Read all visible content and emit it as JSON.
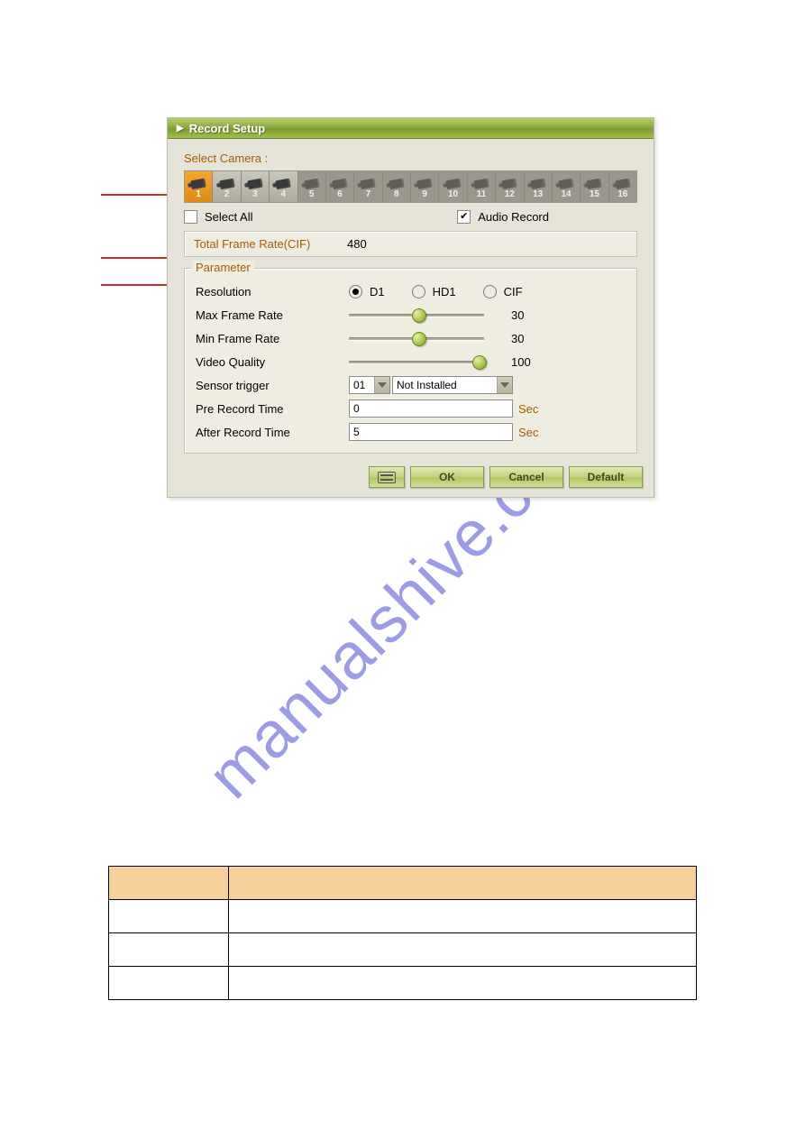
{
  "watermark_text": "manualshive.com",
  "dialog": {
    "title": "Record Setup",
    "select_camera_label": "Select Camera :",
    "cameras": [
      "1",
      "2",
      "3",
      "4",
      "5",
      "6",
      "7",
      "8",
      "9",
      "10",
      "11",
      "12",
      "13",
      "14",
      "15",
      "16"
    ],
    "selected_camera_index": 0,
    "available_camera_indices": [
      0,
      1,
      2,
      3
    ],
    "select_all_label": "Select All",
    "select_all_checked": false,
    "audio_record_label": "Audio Record",
    "audio_record_checked": true,
    "total_frame_rate_label": "Total Frame Rate(CIF)",
    "total_frame_rate_value": "480",
    "parameter_legend": "Parameter",
    "resolution_label": "Resolution",
    "resolution_options": [
      "D1",
      "HD1",
      "CIF"
    ],
    "resolution_selected": "D1",
    "max_frame_rate_label": "Max Frame Rate",
    "max_frame_rate_value": "30",
    "min_frame_rate_label": "Min Frame Rate",
    "min_frame_rate_value": "30",
    "video_quality_label": "Video Quality",
    "video_quality_value": "100",
    "sensor_trigger_label": "Sensor trigger",
    "sensor_trigger_num": "01",
    "sensor_trigger_status": "Not Installed",
    "pre_record_time_label": "Pre Record Time",
    "pre_record_time_value": "0",
    "after_record_time_label": "After Record Time",
    "after_record_time_value": "5",
    "sec_unit": "Sec",
    "buttons": {
      "ok": "OK",
      "cancel": "Cancel",
      "default": "Default"
    }
  },
  "table": {
    "headers": [
      "",
      ""
    ],
    "rows": [
      [
        "",
        ""
      ],
      [
        "",
        ""
      ],
      [
        "",
        ""
      ]
    ]
  }
}
